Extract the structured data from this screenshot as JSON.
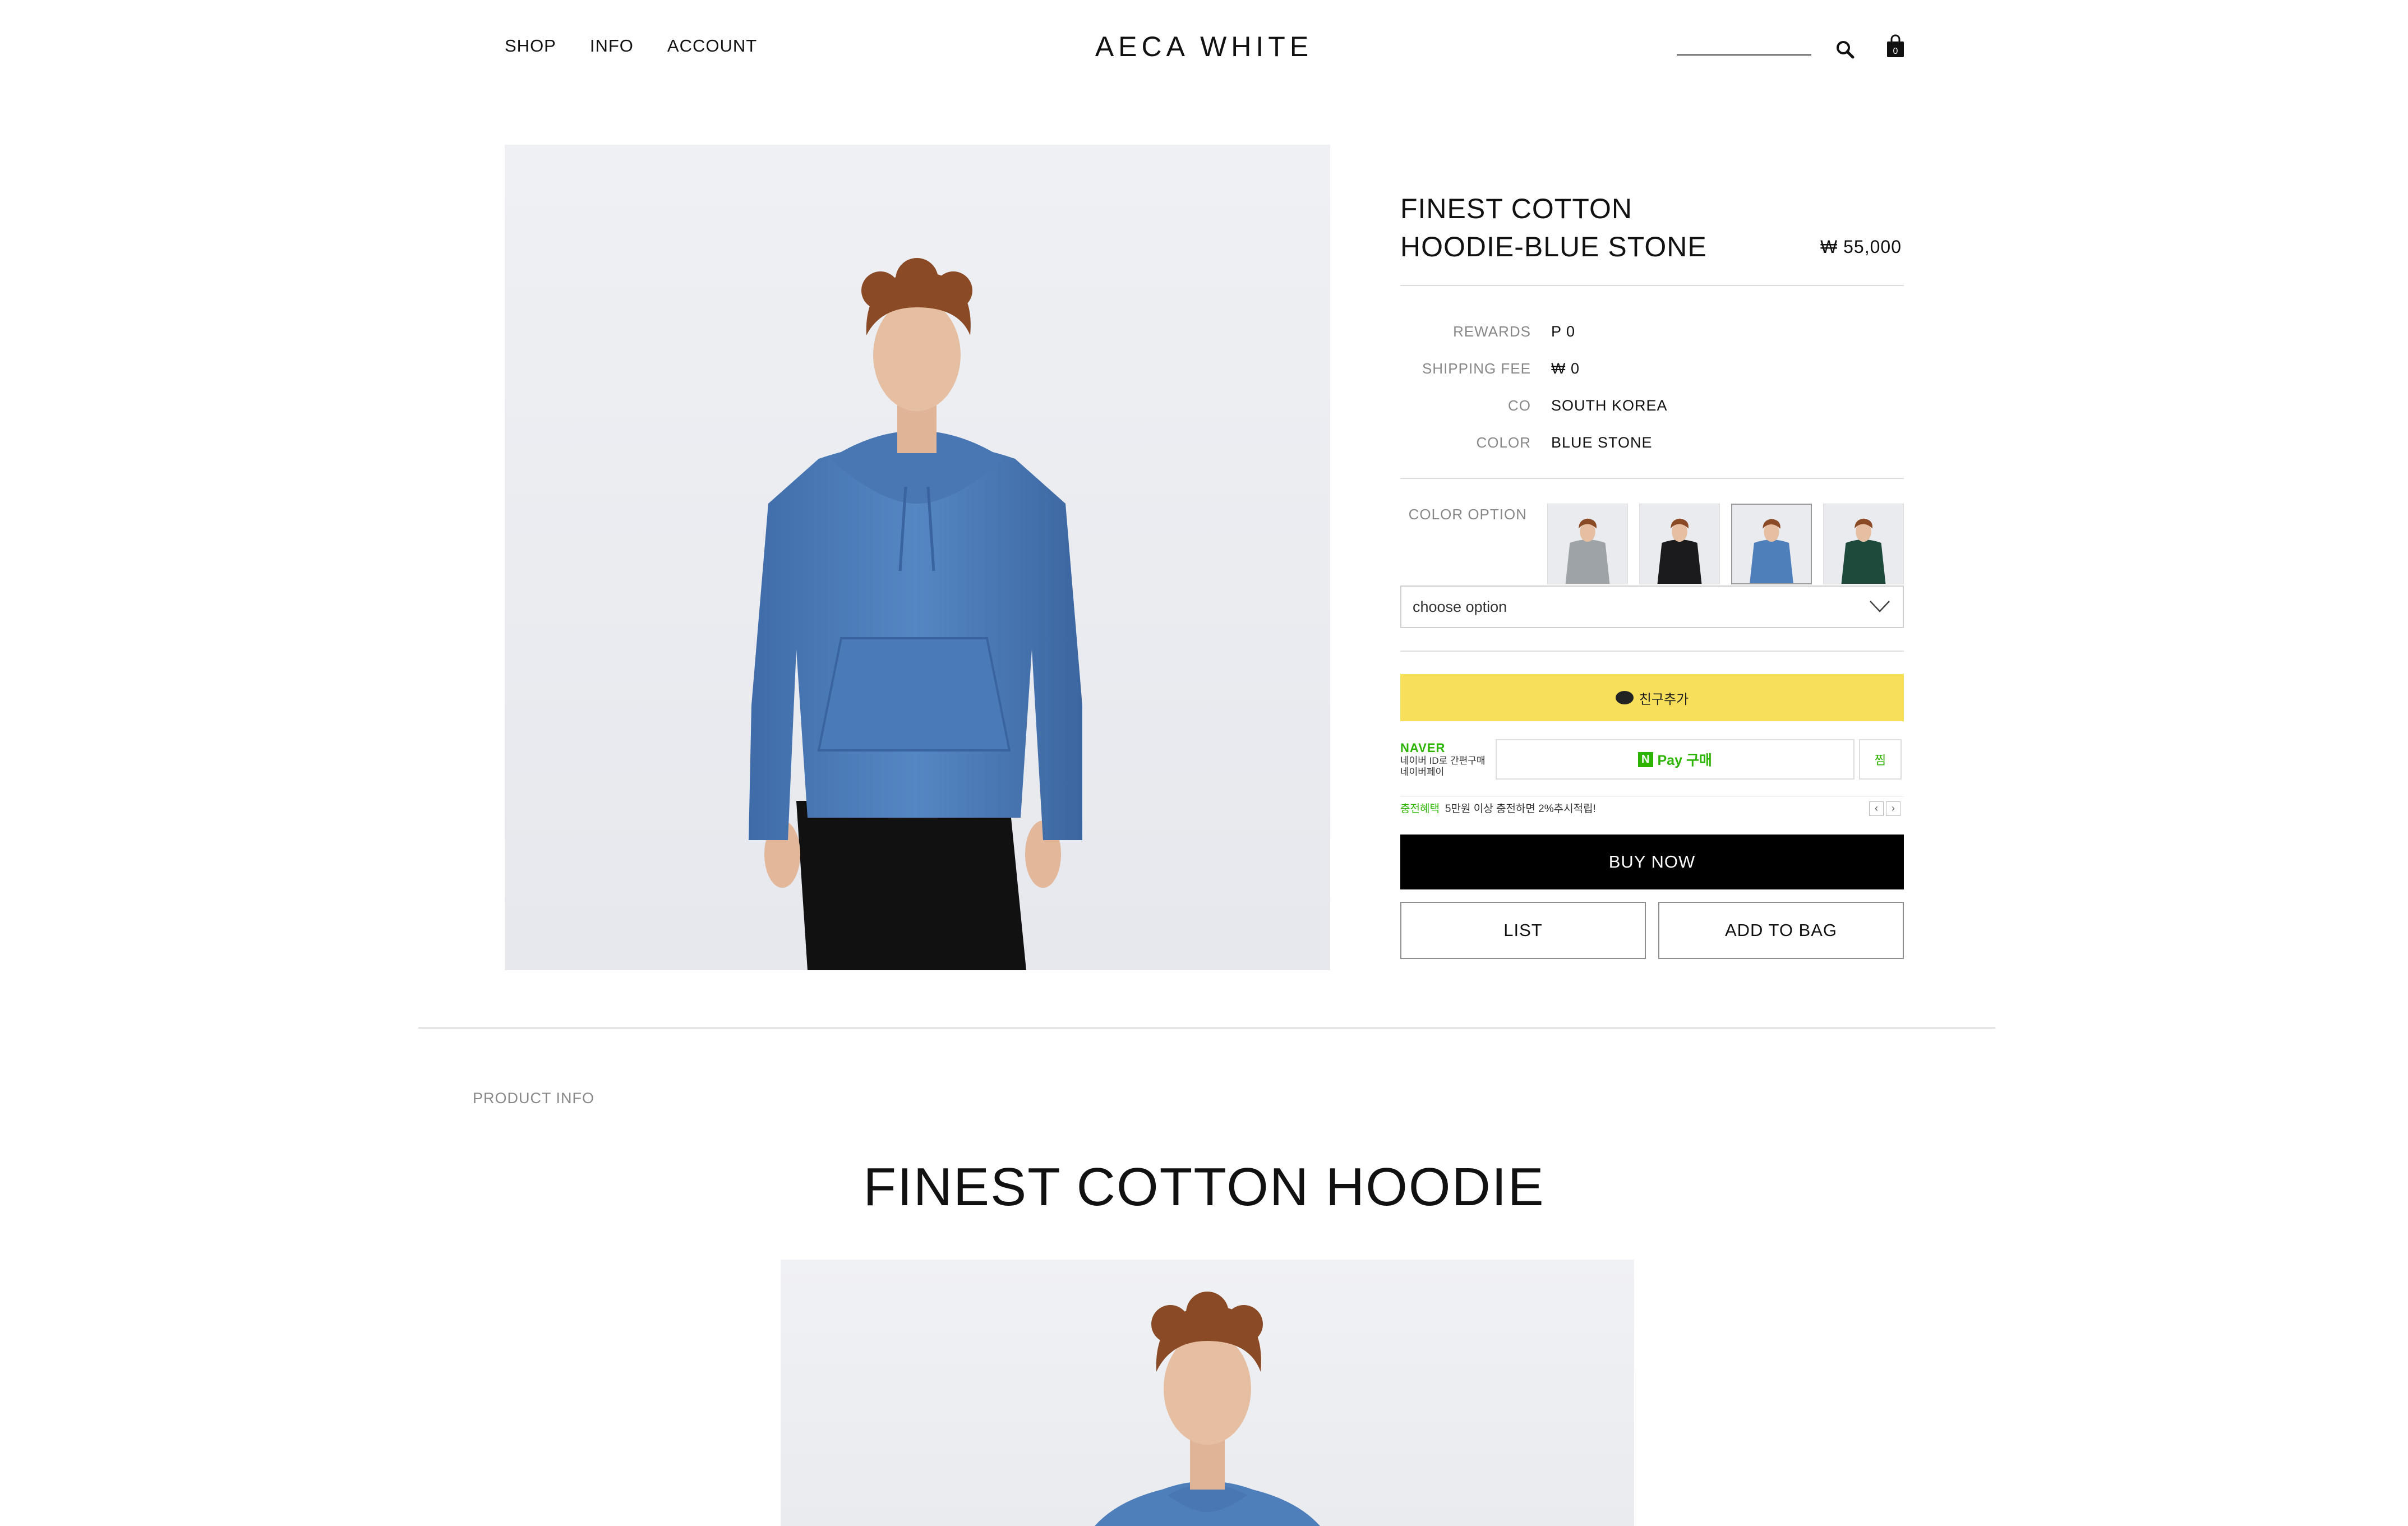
{
  "header": {
    "nav": [
      "SHOP",
      "INFO",
      "ACCOUNT"
    ],
    "logo": "AECA WHITE",
    "bag_count": "0"
  },
  "product": {
    "title_line1": "FINEST COTTON",
    "title_line2": "HOODIE-BLUE STONE",
    "price": "₩ 55,000",
    "info": [
      {
        "label": "REWARDS",
        "value": "P 0"
      },
      {
        "label": "SHIPPING FEE",
        "value": "₩ 0"
      },
      {
        "label": "CO",
        "value": "SOUTH KOREA"
      },
      {
        "label": "COLOR",
        "value": "BLUE STONE"
      }
    ],
    "color_option_label": "COLOR OPTION",
    "swatch_colors": [
      "#9ea3a8",
      "#1b1b1d",
      "#4f7fbb",
      "#1e4a3c"
    ],
    "selected_swatch": 2,
    "select_placeholder": "choose option"
  },
  "kakao": {
    "label": "친구추가"
  },
  "naver": {
    "brand": "NAVER",
    "sub1": "네이버 ID로 간편구매",
    "sub2": "네이버페이",
    "pay_label": "Pay 구매",
    "n_badge": "N",
    "zzim": "찜",
    "benefit_green": "충전혜택",
    "benefit_text": "5만원 이상 충전하면 2%추시적립!"
  },
  "actions": {
    "buy_now": "BUY NOW",
    "list": "LIST",
    "add_to_bag": "ADD TO BAG"
  },
  "detail": {
    "section_label": "PRODUCT INFO",
    "title": "FINEST COTTON HOODIE"
  },
  "colors": {
    "hoodie": "#4f7fbb",
    "kakao": "#f7de5b",
    "naver_green": "#2db400"
  }
}
